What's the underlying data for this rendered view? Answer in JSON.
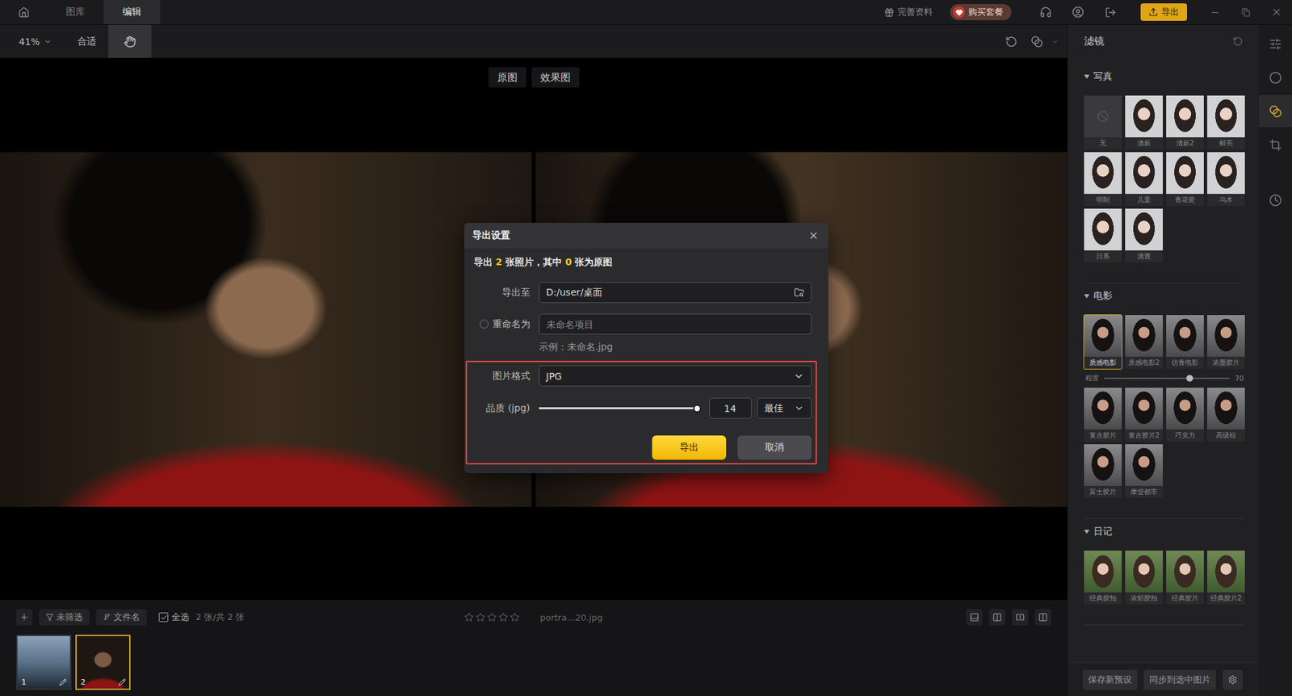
{
  "app_bar": {
    "tabs": [
      {
        "label": "图库",
        "selected": false
      },
      {
        "label": "编辑",
        "selected": true
      }
    ],
    "profile_link": "完善资料",
    "buy_button": "购买套餐",
    "export_button": "导出"
  },
  "toolbar": {
    "zoom": "41%",
    "fit_button": "合适",
    "hand_tool_selected": true
  },
  "canvas": {
    "view_labels": [
      {
        "label": "原图"
      },
      {
        "label": "效果图"
      }
    ]
  },
  "export_dialog": {
    "title": "导出设置",
    "highlighted": true,
    "summary": [
      {
        "text": "导出 ",
        "highlight": false
      },
      {
        "text": "2",
        "highlight": true
      },
      {
        "text": " 张照片，其中 ",
        "highlight": false
      },
      {
        "text": "0",
        "highlight": true
      },
      {
        "text": " 张为原图",
        "highlight": false
      }
    ],
    "destination": {
      "label": "导出至",
      "value": "D:/user/桌面"
    },
    "rename": {
      "label": "重命名为",
      "checked": false,
      "placeholder": "未命名项目"
    },
    "example": "示例：未命名.jpg",
    "format": {
      "label": "图片格式",
      "value": "JPG"
    },
    "quality": {
      "label": "品质 (jpg)",
      "level": 1,
      "value": "14",
      "preset": "最佳"
    },
    "buttons": [
      {
        "label": "导出",
        "primary": true
      },
      {
        "label": "取消",
        "primary": false
      }
    ]
  },
  "filter_panel": {
    "title": "滤镜",
    "sections": [
      {
        "title": "写真",
        "expanded": true,
        "tiles": [
          {
            "label": "无",
            "selected": false,
            "kind": "none"
          },
          {
            "label": "清新",
            "selected": false,
            "kind": "photo"
          },
          {
            "label": "清新2",
            "selected": false,
            "kind": "photo"
          },
          {
            "label": "鲜亮",
            "selected": false,
            "kind": "photo"
          },
          {
            "label": "明制",
            "selected": false,
            "kind": "photo"
          },
          {
            "label": "儿童",
            "selected": false,
            "kind": "photo"
          },
          {
            "label": "青花瓷",
            "selected": false,
            "kind": "photo"
          },
          {
            "label": "乌木",
            "selected": false,
            "kind": "photo"
          },
          {
            "label": "日系",
            "selected": false,
            "kind": "photo"
          },
          {
            "label": "清透",
            "selected": false,
            "kind": "photo"
          }
        ]
      },
      {
        "title": "电影",
        "expanded": true,
        "slider": {
          "label": "程度",
          "level": 0.68,
          "reading": "70"
        },
        "tiles": [
          {
            "label": "质感电影",
            "selected": true,
            "kind": "photo"
          },
          {
            "label": "质感电影2",
            "selected": false,
            "kind": "photo"
          },
          {
            "label": "仿青电影",
            "selected": false,
            "kind": "photo"
          },
          {
            "label": "浓墨胶片",
            "selected": false,
            "kind": "photo"
          },
          {
            "label": "复古胶片",
            "selected": false,
            "kind": "photo"
          },
          {
            "label": "复古胶片2",
            "selected": false,
            "kind": "photo"
          },
          {
            "label": "巧克力",
            "selected": false,
            "kind": "photo"
          },
          {
            "label": "高级棕",
            "selected": false,
            "kind": "photo"
          },
          {
            "label": "富士胶片",
            "selected": false,
            "kind": "photo"
          },
          {
            "label": "摩登都市",
            "selected": false,
            "kind": "photo"
          }
        ]
      },
      {
        "title": "日记",
        "expanded": true,
        "tiles": [
          {
            "label": "经典胶拍",
            "selected": false,
            "kind": "photo"
          },
          {
            "label": "浓郁胶拍",
            "selected": false,
            "kind": "photo"
          },
          {
            "label": "经典胶片",
            "selected": false,
            "kind": "photo"
          },
          {
            "label": "经典胶片2",
            "selected": false,
            "kind": "photo"
          }
        ]
      }
    ],
    "buttons": [
      "保存新预设",
      "同步到选中图片"
    ]
  },
  "right_rail": {
    "tools": [
      {
        "selected": false
      },
      {
        "selected": false
      },
      {
        "selected": true
      },
      {
        "selected": false
      },
      {
        "selected": false
      }
    ]
  },
  "filmstrip": {
    "filter_button": "未筛选",
    "sort_button": "文件名",
    "select_all": {
      "label": "全选",
      "checked": true
    },
    "count": "2 张/共 2 张",
    "stars": 0,
    "filename": "portra...20.jpg",
    "thumbnails": [
      {
        "number": "1",
        "selected": false
      },
      {
        "number": "2",
        "selected": true
      }
    ]
  }
}
